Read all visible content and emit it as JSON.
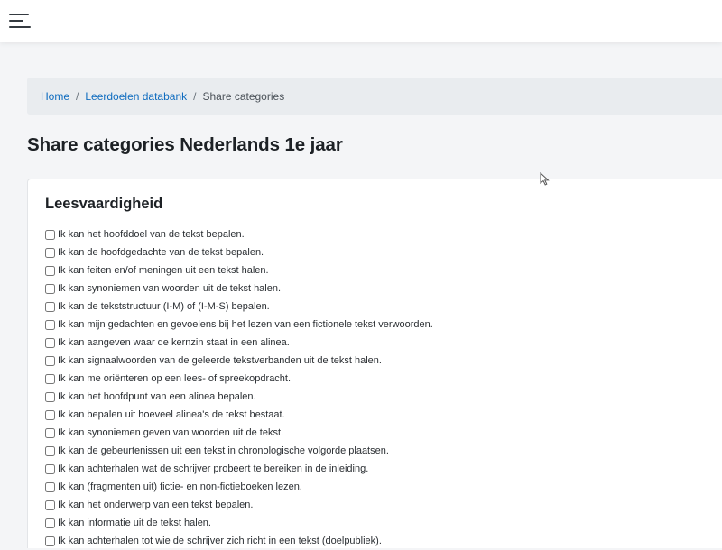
{
  "breadcrumb": {
    "home": "Home",
    "databank": "Leerdoelen databank",
    "separator": "/",
    "current": "Share categories"
  },
  "page": {
    "title": "Share categories Nederlands 1e jaar"
  },
  "section": {
    "title": "Leesvaardigheid",
    "items": [
      "Ik kan het hoofddoel van de tekst bepalen.",
      "Ik kan de hoofdgedachte van de tekst bepalen.",
      "Ik kan feiten en/of meningen uit een tekst halen.",
      "Ik kan synoniemen van woorden uit de tekst halen.",
      "Ik kan de tekststructuur (I-M) of (I-M-S) bepalen.",
      "Ik kan mijn gedachten en gevoelens bij het lezen van een fictionele tekst verwoorden.",
      "Ik kan aangeven waar de kernzin staat in een alinea.",
      "Ik kan signaalwoorden van de geleerde tekstverbanden uit de tekst halen.",
      "Ik kan me oriënteren op een lees- of spreekopdracht.",
      "Ik kan het hoofdpunt van een alinea bepalen.",
      "Ik kan bepalen uit hoeveel alinea's de tekst bestaat.",
      "Ik kan synoniemen geven van woorden uit de tekst.",
      "Ik kan de gebeurtenissen uit een tekst in chronologische volgorde plaatsen.",
      "Ik kan achterhalen wat de schrijver probeert te bereiken in de inleiding.",
      "Ik kan (fragmenten uit) fictie- en non-fictieboeken lezen.",
      "Ik kan het onderwerp van een tekst bepalen.",
      "Ik kan informatie uit de tekst halen.",
      "Ik kan achterhalen tot wie de schrijver zich richt in een tekst (doelpubliek)."
    ]
  },
  "icons": {
    "menu": "hamburger-menu-icon",
    "cursor": "mouse-pointer-icon"
  },
  "colors": {
    "link": "#0f6cbf",
    "breadcrumb_bg": "#e9ecef",
    "page_bg": "#f4f5f7",
    "card_bg": "#ffffff"
  }
}
